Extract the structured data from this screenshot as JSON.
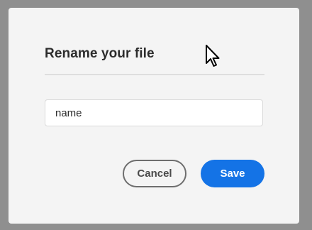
{
  "dialog": {
    "title": "Rename your file",
    "input": {
      "value": "name",
      "placeholder": ""
    },
    "cancel_label": "Cancel",
    "save_label": "Save"
  },
  "colors": {
    "overlay": "#8f8f8f",
    "dialog_bg": "#f4f4f4",
    "primary": "#1473e6",
    "text": "#2c2c2c"
  },
  "cursor": {
    "icon": "arrow-pointer-icon"
  }
}
